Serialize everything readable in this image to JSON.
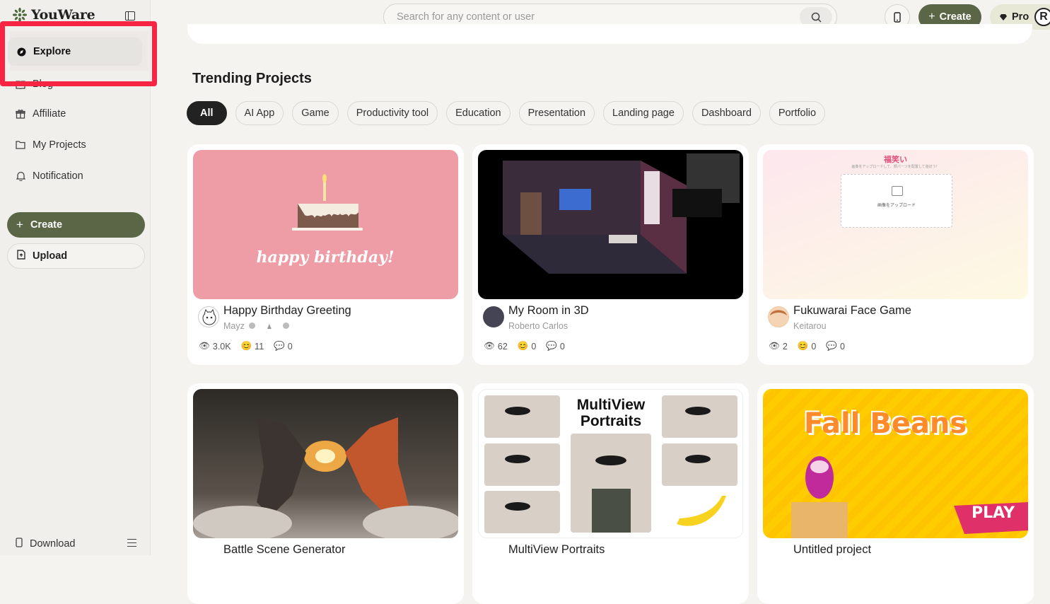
{
  "app": {
    "name": "YouWare"
  },
  "sidebar": {
    "items": [
      {
        "label": "Explore",
        "icon": "compass-icon"
      },
      {
        "label": "Blog",
        "icon": "book-icon"
      },
      {
        "label": "Affiliate",
        "icon": "gift-icon"
      },
      {
        "label": "My Projects",
        "icon": "folder-icon"
      },
      {
        "label": "Notification",
        "icon": "bell-icon"
      }
    ],
    "create_label": "Create",
    "upload_label": "Upload",
    "download_label": "Download"
  },
  "header": {
    "search_placeholder": "Search for any content or user",
    "create_label": "Create",
    "pro_label": "Pro",
    "avatar_letter": "R"
  },
  "main": {
    "section_title": "Trending Projects",
    "filters": [
      "All",
      "AI App",
      "Game",
      "Productivity tool",
      "Education",
      "Presentation",
      "Landing page",
      "Dashboard",
      "Portfolio"
    ],
    "active_filter": "All",
    "cards": [
      {
        "title": "Happy Birthday Greeting",
        "author": "Mayz",
        "views": "3.0K",
        "reactions": "11",
        "comments": "0",
        "thumb_text": "happy birthday!"
      },
      {
        "title": "My Room in 3D",
        "author": "Roberto Carlos",
        "views": "62",
        "reactions": "0",
        "comments": "0"
      },
      {
        "title": "Fukuwarai Face Game",
        "author": "Keitarou",
        "views": "2",
        "reactions": "0",
        "comments": "0",
        "thumb_heading": "福笑い",
        "thumb_sub": "画像をアップロードして、顔パーツを配置して遊ぼう！",
        "thumb_upload": "画像をアップロード"
      },
      {
        "title": "Battle Scene Generator"
      },
      {
        "title": "MultiView Portraits",
        "thumb_title": "MultiView Portraits"
      },
      {
        "title": "Untitled project",
        "thumb_title": "Fall Beans",
        "thumb_play": "PLAY"
      }
    ]
  },
  "colors": {
    "accent": "#5a6646",
    "highlight": "#f72444",
    "chip_active": "#222222"
  }
}
